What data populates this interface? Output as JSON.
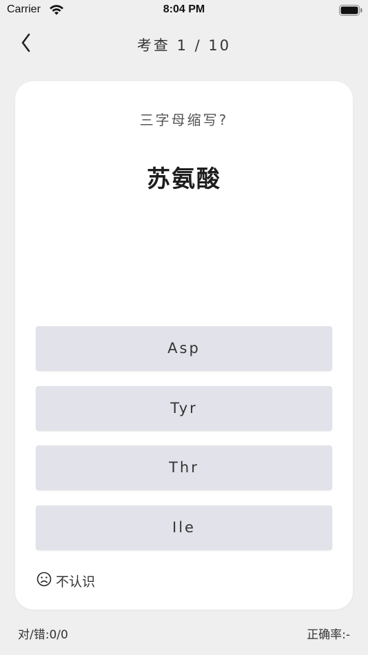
{
  "status_bar": {
    "carrier": "Carrier",
    "time": "8:04 PM",
    "icons": [
      "wifi-icon",
      "battery-icon"
    ]
  },
  "nav": {
    "back_icon": "chevron-left-icon",
    "title": "考查 1 / 10"
  },
  "question": {
    "prompt": "三字母缩写?",
    "word": "苏氨酸"
  },
  "options": [
    {
      "label": "Asp"
    },
    {
      "label": "Tyr"
    },
    {
      "label": "Thr"
    },
    {
      "label": "Ile"
    }
  ],
  "unknown": {
    "icon": "sad-face-icon",
    "label": "不认识"
  },
  "footer": {
    "score": "对/错:0/0",
    "accuracy": "正确率:-"
  },
  "colors": {
    "background": "#efefef",
    "card": "#ffffff",
    "option_bg": "#e2e2ea",
    "text": "#333333"
  }
}
